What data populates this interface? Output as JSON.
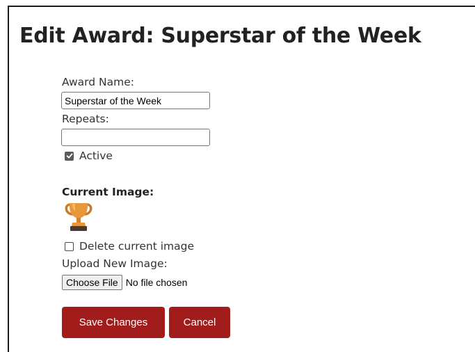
{
  "page": {
    "title": "Edit Award: Superstar of the Week"
  },
  "form": {
    "award_name_label": "Award Name:",
    "award_name_value": "Superstar of the Week",
    "repeats_label": "Repeats:",
    "repeats_value": "",
    "active_label": "Active",
    "active_checked": true,
    "current_image_heading": "Current Image:",
    "current_image_icon": "trophy-icon",
    "delete_image_label": "Delete current image",
    "delete_image_checked": false,
    "upload_label": "Upload New Image:",
    "choose_file_label": "Choose File",
    "file_status": "No file chosen",
    "save_label": "Save Changes",
    "cancel_label": "Cancel"
  },
  "colors": {
    "primary_button": "#a21c1c",
    "trophy_gold": "#e8973a"
  }
}
